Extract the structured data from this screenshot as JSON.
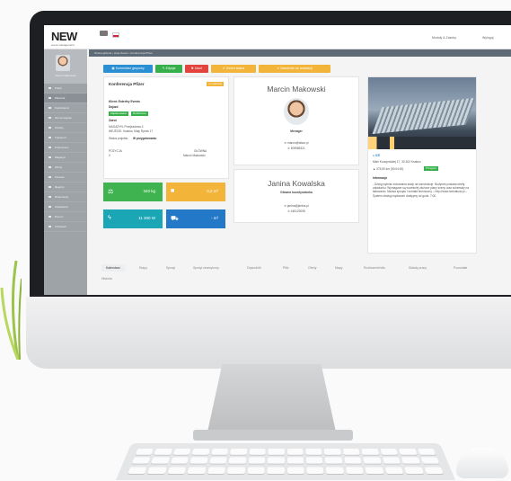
{
  "app": {
    "logo": "NEW",
    "logo_sub": "event management"
  },
  "topbar": {
    "link_1": "Moduły & Zasoby",
    "link_2": "Wyloguj"
  },
  "breadcrumb": "Strona główna › Lista zleceń › Konferencja Pfizer",
  "profile": {
    "name": "Marcin Makowski"
  },
  "sidebar": {
    "items": [
      "Pulpit",
      "Zlecenia",
      "Kontrahenci",
      "Harmonogram",
      "Zasoby",
      "Transport",
      "Pracownicy",
      "Magazyn",
      "Oferty",
      "Finanse",
      "Raporty",
      "Dokumenty",
      "Ustawienia",
      "Pomoc",
      "Archiwum"
    ]
  },
  "toolbar": {
    "group_comment": "Komentarz grupowy",
    "edit": "Edycja",
    "delete": "Usuń",
    "order_status": "Zmień status",
    "order_confirm": "Zatwierdź do realizacji"
  },
  "event": {
    "title": "Konferencja Pfizer",
    "status": "w realizacji",
    "client": "Klient: Enterfey Events",
    "section_1": "Dojazd",
    "tag_1": "Zaplanowane",
    "tag_2": "Rozliczone",
    "section_2": "Zwrot",
    "address_1": "MAGAZYN: Przejazdowa 3",
    "address_2": "WEJŚCIE: Kraków, Mały Rynek 17",
    "project_status_label": "Status projektu:",
    "project_status": "W przygotowaniu",
    "footer_left_label": "POZYCJA",
    "footer_left_value": "0",
    "footer_right_label": "GŁÓWNA",
    "footer_right_value": "Marcin Makowski"
  },
  "tiles": [
    {
      "icon": "weight-icon",
      "glyph": "⚖",
      "value": "340 kg"
    },
    {
      "icon": "box-icon",
      "glyph": "■",
      "value": "0,2 m³"
    },
    {
      "icon": "power-icon",
      "glyph": "ϟ",
      "value": "11 300 W"
    },
    {
      "icon": "truck-icon",
      "glyph": "⛟",
      "value": "- m³"
    }
  ],
  "manager": {
    "name": "Marcin Makowski",
    "role": "Menager",
    "email": "marcin@stiwo.pl",
    "phone": "509985321"
  },
  "coordinator": {
    "name": "Janina Kowalska",
    "role": "Główna koordynatorka",
    "email": "janina@janina.pl",
    "phone": "445123098"
  },
  "venue": {
    "name": "ICE",
    "address": "Marii Konopnickiej 17, 30-302 Kraków",
    "distance": "375,50 km (00:04:00)",
    "action": "Przejazd",
    "info_title": "Informacje",
    "info_text": "- Dźwig wymiar dokowania stacji na konstrukcje. Budynek posiada strefę załadunku. Wymagane są wcześniej złożone plany sceny oraz schematy na ładowaniu. Nazwa sprzętu i kontakt techniczny – http://www.icekrakow.pl – System obsługi wydarzeń dostępny od godz. 7:00."
  },
  "tabs": [
    "Kalendarz",
    "Etapy",
    "Sprzęt",
    "Sprzęt zewnętrzny",
    "Dojazd/dh",
    "Pliki",
    "Oferty",
    "Mapy",
    "Rozliczenie/dla",
    "Składy pracy",
    "Pozostałe",
    "Historia"
  ]
}
